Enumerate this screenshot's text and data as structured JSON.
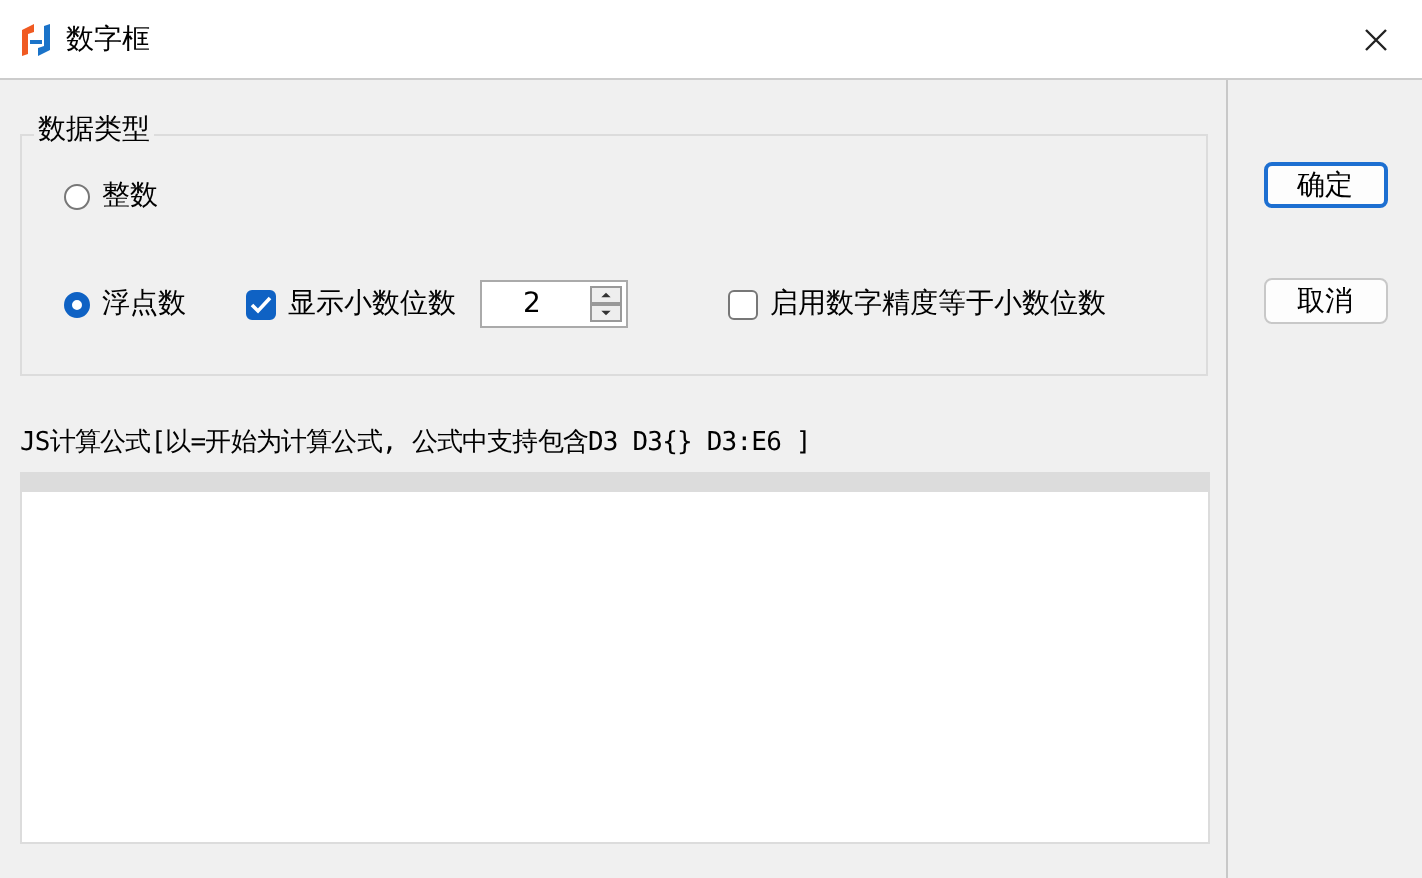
{
  "window": {
    "title": "数字框"
  },
  "data_type": {
    "title": "数据类型",
    "options": [
      {
        "label": "整数",
        "selected": false
      },
      {
        "label": "浮点数",
        "selected": true
      }
    ],
    "show_decimals": {
      "label": "显示小数位数",
      "checked": true
    },
    "decimals": {
      "value": "2"
    },
    "precision": {
      "label": "启用数字精度等于小数位数",
      "checked": false
    }
  },
  "formula": {
    "label": "JS计算公式[以=开始为计算公式, 公式中支持包含D3 D3{} D3:E6 ]"
  },
  "buttons": [
    {
      "label": "确定",
      "default": true
    },
    {
      "label": "取消",
      "default": false
    }
  ]
}
